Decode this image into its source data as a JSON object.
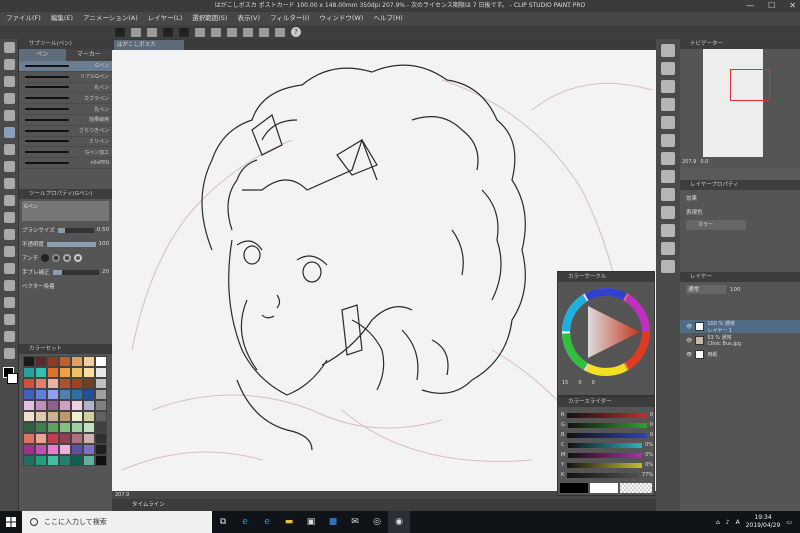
{
  "window": {
    "title": "はがこしボスカ ポストカード 100.00 x 148.00mm 350dpi 207.9% - 次のライセンス期限は 7 日後です。 - CLIP STUDIO PAINT PRO",
    "minimize": "—",
    "maximize": "☐",
    "close": "✕"
  },
  "menu": [
    "ファイル(F)",
    "編集(E)",
    "アニメーション(A)",
    "レイヤー(L)",
    "選択範囲(S)",
    "表示(V)",
    "フィルター(I)",
    "ウィンドウ(W)",
    "ヘルプ(H)"
  ],
  "canvas_tab": "はがこしボスカ",
  "subtool": {
    "title": "サブツール(ペン)",
    "tabs": [
      "ペン",
      "マーカー"
    ],
    "brushes": [
      "Gペン",
      "リアルGペン",
      "丸ペン",
      "カブラペン",
      "丸ペン",
      "効果線用",
      "ざらつきペン",
      "ミリペン",
      "Gペン加工",
      "nilsPEN"
    ]
  },
  "tool_property": {
    "title": "ツールプロパティ(Gペン)",
    "name": "Gペン",
    "brush_size_label": "ブラシサイズ",
    "brush_size": "0.50",
    "opacity_label": "不透明度",
    "opacity": "100",
    "antialias_label": "アンチ",
    "stabilize_label": "手ブレ補正",
    "stabilize": "20",
    "vector_label": "ベクター吸着"
  },
  "colorset": {
    "title": "カラーセット",
    "swatches": [
      "#1a1a1a",
      "#5a2a2a",
      "#8a3a2a",
      "#c06030",
      "#e0a060",
      "#f0d0a0",
      "#ffffff",
      "#2aa0a0",
      "#30c0b0",
      "#e07030",
      "#f0a040",
      "#f0c060",
      "#f8e0a0",
      "#e8e8e8",
      "#d05040",
      "#e08070",
      "#f0b0a0",
      "#b05030",
      "#a04020",
      "#704020",
      "#c0c0c0",
      "#4060c0",
      "#6080e0",
      "#90a0f0",
      "#5080b0",
      "#3070a0",
      "#2050a0",
      "#a0a0a0",
      "#e0c0e0",
      "#c090c0",
      "#906090",
      "#d0a0c0",
      "#f0d0e0",
      "#b0b0d0",
      "#808080",
      "#f0e0d0",
      "#e0c8b0",
      "#d0b090",
      "#c09870",
      "#f0f0d0",
      "#d0d0a0",
      "#606060",
      "#306040",
      "#408050",
      "#60a060",
      "#80c080",
      "#a0d0a0",
      "#c0e0c0",
      "#404040",
      "#e07060",
      "#f0a090",
      "#c04050",
      "#904050",
      "#b07080",
      "#d0b0b0",
      "#303030",
      "#a03090",
      "#c050b0",
      "#e080d0",
      "#f0b0e0",
      "#6050a0",
      "#8070c0",
      "#202020",
      "#207060",
      "#20a080",
      "#40c0a0",
      "#208070",
      "#106050",
      "#60b0a0",
      "#101010"
    ]
  },
  "canvas_status": "207.9",
  "timeline": "タイムライン",
  "navigator": {
    "title": "ナビゲーター",
    "zoom": "207.9",
    "angle": "0.0"
  },
  "layer_property": {
    "title": "レイヤープロパティ",
    "effect_label": "効果",
    "expression_color_label": "表現色",
    "expression_color_value": "カラー"
  },
  "layer": {
    "title": "レイヤー",
    "blend": "通常",
    "opacity": "100",
    "rows": [
      {
        "name": "100 % 通常",
        "sub": "レイヤー 1",
        "selected": true
      },
      {
        "name": "53 % 通常",
        "sub": "Clinic Bus.jpg",
        "selected": false
      },
      {
        "name": "用紙",
        "sub": "",
        "selected": false
      }
    ]
  },
  "color_wheel": {
    "title": "カラーサークル",
    "h": "15",
    "s": "0",
    "v": "0"
  },
  "color_slider": {
    "title": "カラースライダー",
    "rows": [
      {
        "label": "R",
        "value": "0",
        "color": "#c03030"
      },
      {
        "label": "G",
        "value": "0",
        "color": "#30a030"
      },
      {
        "label": "B",
        "value": "0",
        "color": "#3040c0"
      },
      {
        "label": "C",
        "value": "0%",
        "color": "#30b0c0"
      },
      {
        "label": "M",
        "value": "0%",
        "color": "#b030a0"
      },
      {
        "label": "Y",
        "value": "0%",
        "color": "#c0c030"
      },
      {
        "label": "K",
        "value": "77%",
        "color": "#505050"
      }
    ]
  },
  "taskbar": {
    "search_placeholder": "ここに入力して検索",
    "time": "19:34",
    "date": "2019/04/29",
    "ime": "A"
  }
}
